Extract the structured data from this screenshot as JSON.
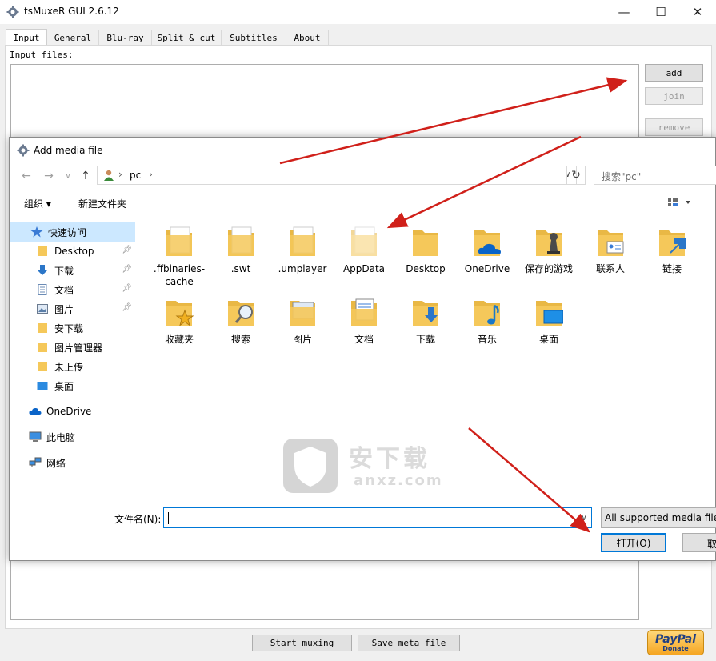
{
  "app": {
    "title": "tsMuxeR GUI 2.6.12",
    "caption": {
      "minimize": "—",
      "maximize": "☐",
      "close": "✕"
    }
  },
  "tabs": [
    "Input",
    "General",
    "Blu-ray",
    "Split & cut",
    "Subtitles",
    "About"
  ],
  "input": {
    "files_label": "Input files:",
    "buttons": {
      "add": "add",
      "join": "join",
      "remove": "remove"
    }
  },
  "footer": {
    "start": "Start muxing",
    "save_meta": "Save meta file",
    "paypal_brand": "PayPal",
    "paypal_donate": "Donate"
  },
  "dialog": {
    "title": "Add media file",
    "address": {
      "path": "pc",
      "separator": "›"
    },
    "search_placeholder": "搜索\"pc\"",
    "commands": {
      "organize": "组织 ▾",
      "new_folder": "新建文件夹"
    },
    "nav_items": [
      {
        "label": "快速访问",
        "icon": "star",
        "pinned": false,
        "selected": true
      },
      {
        "label": "Desktop",
        "icon": "folder",
        "pinned": true
      },
      {
        "label": "下载",
        "icon": "download",
        "pinned": true
      },
      {
        "label": "文档",
        "icon": "document",
        "pinned": true
      },
      {
        "label": "图片",
        "icon": "picture",
        "pinned": true
      },
      {
        "label": "安下载",
        "icon": "folder",
        "pinned": false
      },
      {
        "label": "图片管理器",
        "icon": "folder",
        "pinned": false
      },
      {
        "label": "未上传",
        "icon": "folder",
        "pinned": false
      },
      {
        "label": "桌面",
        "icon": "desktop",
        "pinned": false
      }
    ],
    "nav_roots": [
      {
        "label": "OneDrive",
        "icon": "cloud"
      },
      {
        "label": "此电脑",
        "icon": "computer"
      },
      {
        "label": "网络",
        "icon": "network"
      }
    ],
    "files_row1": [
      {
        "name": ".ffbinaries-cache",
        "overlay": "pages"
      },
      {
        "name": ".swt",
        "overlay": "pages"
      },
      {
        "name": ".umplayer",
        "overlay": "pages"
      },
      {
        "name": "AppData",
        "overlay": "pages-faded"
      },
      {
        "name": "Desktop",
        "overlay": "none"
      },
      {
        "name": "OneDrive",
        "overlay": "cloud"
      },
      {
        "name": "保存的游戏",
        "overlay": "chess"
      },
      {
        "name": "联系人",
        "overlay": "contact"
      },
      {
        "name": "链接",
        "overlay": "link"
      }
    ],
    "files_row2": [
      {
        "name": "收藏夹",
        "overlay": "star"
      },
      {
        "name": "搜索",
        "overlay": "search"
      },
      {
        "name": "图片",
        "overlay": "picture"
      },
      {
        "name": "文档",
        "overlay": "document"
      },
      {
        "name": "下载",
        "overlay": "download"
      },
      {
        "name": "音乐",
        "overlay": "music"
      },
      {
        "name": "桌面",
        "overlay": "desktop"
      }
    ],
    "filename_label": "文件名(N):",
    "filename_value": "",
    "filter": "All supported media files",
    "open": "打开(O)",
    "cancel": "取消"
  },
  "watermark": {
    "text": "安下载",
    "sub": "anxz.com"
  },
  "colors": {
    "accent": "#0078d7",
    "folder": "#f5c85a",
    "arrow": "#d0201a",
    "selection": "#cce8ff"
  }
}
